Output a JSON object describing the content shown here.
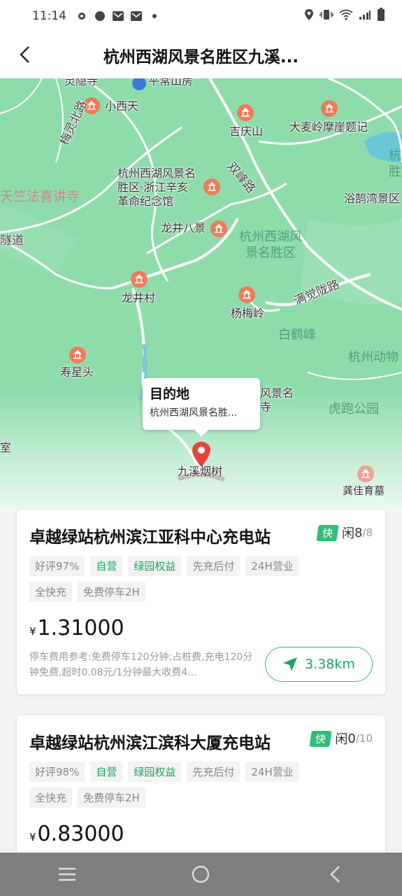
{
  "status_bar": {
    "time": "11:14"
  },
  "header": {
    "title": "杭州西湖风景名胜区九溪..."
  },
  "map": {
    "labels": {
      "lingyin": "灵隐寺",
      "pingchang": "平常山房",
      "xiaoxitian": "小西天",
      "jiqingshan": "吉庆山",
      "damailing": "大麦岭摩崖题记",
      "meilingbei": "梅灵北路",
      "xihu_memorial": "杭州西湖风景名\n胜区·浙江辛亥\n革命纪念馆",
      "tianzhu": "天竺法喜讲寺",
      "shuangfeng": "双峰路",
      "yugeliwan": "浴鹄湾景区",
      "suidao": "隧道",
      "longjing8": "龙井八景",
      "xihu_area": "杭州西湖风\n景名胜区",
      "longjingcun": "龙井村",
      "yangmeiling": "杨梅岭",
      "manjuelong": "满觉陇路",
      "baihefeng": "白鹤峰",
      "shouxingtou": "寿星头",
      "hangzhou_zoo": "杭州动物",
      "hupao": "虎跑公园",
      "fengjingming": "风景名\n寺",
      "jiuximei": "九溪烟树",
      "shi": "室",
      "gongjiayu": "龚佳育墓",
      "hang_right": "杭\n胜"
    },
    "callout": {
      "title": "目的地",
      "subtitle": "杭州西湖风景名胜..."
    }
  },
  "stations": [
    {
      "name": "卓越绿站杭州滨江亚科中心充电站",
      "fast_label": "快",
      "free_label": "闲",
      "free_count": "8",
      "total": "/8",
      "tags": [
        "好评97%",
        "自营",
        "绿园权益",
        "先充后付",
        "24H营业",
        "全快充",
        "免费停车2H"
      ],
      "currency": "¥",
      "price": "1.31000",
      "parking": "停车费用参考:免费停车120分钟;占桩费,充电120分钟免费,超时0.08元/1分钟最大收费4...",
      "distance": "3.38km"
    },
    {
      "name": "卓越绿站杭州滨江滨科大厦充电站",
      "fast_label": "快",
      "free_label": "闲",
      "free_count": "0",
      "total": "/10",
      "tags": [
        "好评98%",
        "自营",
        "绿园权益",
        "先充后付",
        "24H营业",
        "全快充",
        "免费停车2H"
      ],
      "currency": "¥",
      "price": "0.83000"
    }
  ],
  "colors": {
    "accent": "#2fbf7a",
    "map_green": "#8fdcab",
    "poi": "#f07b5a"
  }
}
